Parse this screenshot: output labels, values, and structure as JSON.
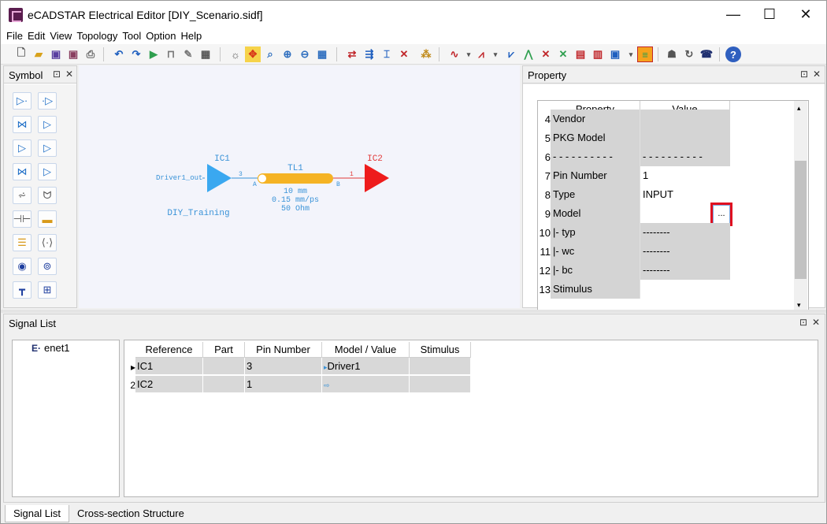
{
  "window": {
    "title": "eCADSTAR Electrical Editor [DIY_Scenario.sidf]",
    "controls": {
      "minimize": "—",
      "maximize": "☐",
      "close": "✕"
    }
  },
  "menu": [
    "File",
    "Edit",
    "View",
    "Topology",
    "Tool",
    "Option",
    "Help"
  ],
  "panels": {
    "symbol": {
      "title": "Symbol"
    },
    "property": {
      "title": "Property"
    },
    "signal_list": {
      "title": "Signal List"
    },
    "pin_icon": "⊡",
    "close_icon": "✕"
  },
  "schematic": {
    "driver_label": "IC1",
    "driver_net": "Driver1_out",
    "driver_pin": "3",
    "tline_label": "TL1",
    "tline_end_a": "A",
    "tline_end_b": "B",
    "tline_length": "10 mm",
    "tline_delay": "0.15 mm/ps",
    "tline_impedance": "50 Ohm",
    "receiver_label": "IC2",
    "receiver_pin": "1",
    "group_label": "DIY_Training",
    "colors": {
      "driver": "#3aa8f0",
      "receiver": "#ee1c1c",
      "tline": "#f5b324",
      "label_blue": "#3a93d8",
      "label_red": "#e23a3a"
    }
  },
  "property_table": {
    "headers": {
      "property": "Property",
      "value": "Value"
    },
    "rows": [
      {
        "num": "4",
        "name": "Vendor",
        "value": "",
        "shaded": true
      },
      {
        "num": "5",
        "name": "PKG Model",
        "value": "",
        "shaded": true
      },
      {
        "num": "6",
        "name": "- - - - - - - - - -",
        "value": "- - - - - - - - - -",
        "shaded": true
      },
      {
        "num": "7",
        "name": "Pin Number",
        "value": "1",
        "shaded": false
      },
      {
        "num": "8",
        "name": "Type",
        "value": "INPUT",
        "shaded": false
      },
      {
        "num": "9",
        "name": "Model",
        "value": "",
        "shaded": false,
        "has_button": true
      },
      {
        "num": "10",
        "name": " |- typ",
        "value": "--------",
        "shaded": true
      },
      {
        "num": "11",
        "name": " |- wc",
        "value": "--------",
        "shaded": true
      },
      {
        "num": "12",
        "name": " |- bc",
        "value": "--------",
        "shaded": true
      },
      {
        "num": "13",
        "name": "Stimulus",
        "value": "",
        "shaded": false
      }
    ],
    "browse_button_label": "...",
    "highlight_color": "#e01020"
  },
  "signal_list": {
    "tree_item": "enet1",
    "tree_icon_glyph": "E·",
    "headers": [
      "Reference",
      "Part",
      "Pin Number",
      "Model / Value",
      "Stimulus"
    ],
    "rows": [
      {
        "marker": "▸",
        "reference": "IC1",
        "part": "",
        "pin": "3",
        "model": "Driver1",
        "model_icon": "▸",
        "stimulus": ""
      },
      {
        "marker": "2",
        "reference": "IC2",
        "part": "",
        "pin": "1",
        "model": "",
        "model_icon": "⇨",
        "stimulus": ""
      }
    ]
  },
  "tabs": [
    "Signal List",
    "Cross-section Structure"
  ],
  "help_icon": "?"
}
